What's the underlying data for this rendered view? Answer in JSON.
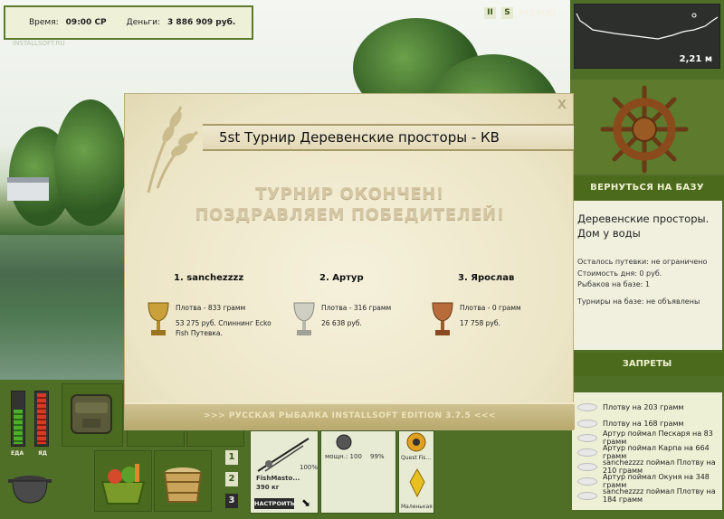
{
  "topbar": {
    "time_label": "Время:",
    "time_value": "09:00 СР",
    "money_label": "Деньги:",
    "money_value": "3 886 909 руб."
  },
  "watermark": "INSTALLSOFT.RU",
  "menu": {
    "pause_label": "II",
    "s_label": "S",
    "menu_label": "МЕНЮ"
  },
  "depth_map": {
    "depth_value": "2,21 м"
  },
  "base": {
    "return_label": "ВЕРНУТЬСЯ НА БАЗУ",
    "name": "Деревенские просторы. Дом у воды",
    "lines": [
      "Осталось путевки: не ограничено",
      "Стоимость дня: 0 руб.",
      "Рыбаков на базе: 1",
      "Турниры на базе: не объявлены"
    ],
    "bans_label": "ЗАПРЕТЫ"
  },
  "log": [
    "Плотву на 203 грамм",
    "Плотву на 168 грамм",
    "Артур поймал Пескаря на 83 грамм",
    "Артур поймал Карпа на 664 грамм",
    "sanchezzzz поймал Плотву на 210 грамм",
    "Артур поймал Окуня на 348 грамм",
    "sanchezzzz поймал Плотву на 184 грамм"
  ],
  "bottom": {
    "food_label": "ЕДА",
    "poison_label": "ЯД",
    "rod_name": "FishMasto...",
    "rod_weight": "390 кг",
    "setup_label": "НАСТРОИТЬ",
    "percent_100": "100%",
    "power_label": "мощн.: 100",
    "percent_99": "99%",
    "line_label": "Quest Fis...",
    "lure_label": "Маленькая",
    "slots": [
      "1",
      "2",
      "3"
    ]
  },
  "modal": {
    "title": "5st Турнир Деревенские просторы - КВ",
    "close_label": "X",
    "headline_1": "ТУРНИР ОКОНЧЕН!",
    "headline_2": "ПОЗДРАВЛЯЕМ ПОБЕДИТЕЛЕЙ!",
    "winners": [
      {
        "name": "1. sanchezzzz",
        "catch": "Плотва - 833 грамм",
        "prize": "53 275 руб. Спиннинг Ecko Fish Путевка."
      },
      {
        "name": "2. Артур",
        "catch": "Плотва - 316 грамм",
        "prize": "26 638 руб."
      },
      {
        "name": "3. Ярослав",
        "catch": "Плотва - 0 грамм",
        "prize": "17 758 руб."
      }
    ],
    "footer": ">>> РУССКАЯ РЫБАЛКА INSTALLSOFT EDITION 3.7.5 <<<"
  },
  "colors": {
    "panel_green": "#4f6e26",
    "modal_bg": "#f6f1dc",
    "gold_cup": "#c9a03a",
    "silver_cup": "#c8c8c0",
    "bronze_cup": "#b86c3a"
  }
}
